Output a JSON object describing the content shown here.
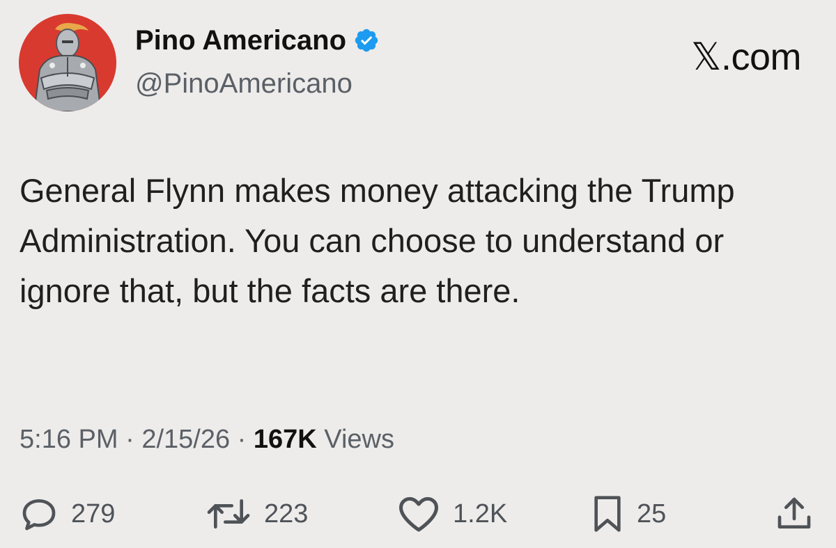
{
  "author": {
    "display_name": "Pino Americano",
    "handle": "@PinoAmericano",
    "verified": true,
    "avatar_icon": "chrome-robot-avatar",
    "badge_color": "#1d9bf0"
  },
  "site": {
    "label": "𝕏.com"
  },
  "tweet": {
    "text": "General Flynn makes money attacking the Trump Administration. You can choose to understand or ignore that, but the facts are there."
  },
  "meta": {
    "time": "5:16 PM",
    "separator": "·",
    "date": "2/15/26",
    "views_count": "167K",
    "views_label": "Views"
  },
  "actions": {
    "replies": {
      "icon": "reply-icon",
      "count": "279"
    },
    "reposts": {
      "icon": "repost-icon",
      "count": "223"
    },
    "likes": {
      "icon": "heart-icon",
      "count": "1.2K"
    },
    "bookmarks": {
      "icon": "bookmark-icon",
      "count": "25"
    },
    "share": {
      "icon": "share-icon"
    }
  },
  "colors": {
    "background": "#edeceb",
    "text": "#1f1f1f",
    "secondary_text": "#5b6066"
  }
}
